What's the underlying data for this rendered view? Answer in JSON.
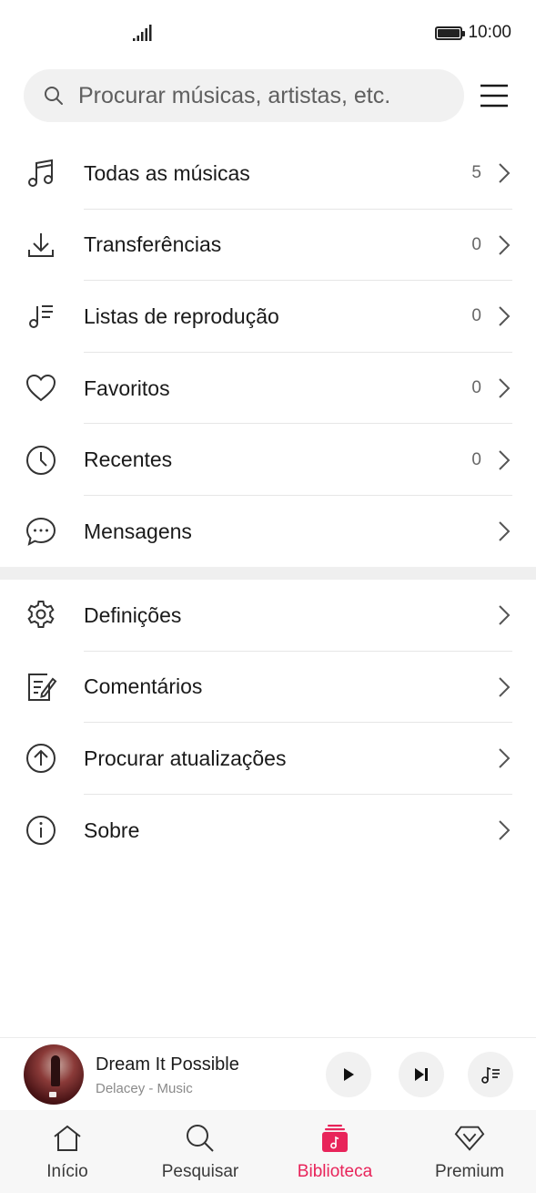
{
  "status_bar": {
    "time": "10:00",
    "icons": [
      "signal-icon",
      "battery-icon"
    ]
  },
  "search": {
    "placeholder": "Procurar músicas, artistas, etc.",
    "icons": [
      "search-icon",
      "menu-icon"
    ]
  },
  "library_items": [
    {
      "label": "Todas as músicas",
      "count": "5",
      "icon": "music-notes-icon"
    },
    {
      "label": "Transferências",
      "count": "0",
      "icon": "download-icon"
    },
    {
      "label": "Listas de reprodução",
      "count": "0",
      "icon": "playlist-icon"
    },
    {
      "label": "Favoritos",
      "count": "0",
      "icon": "heart-icon"
    },
    {
      "label": "Recentes",
      "count": "0",
      "icon": "clock-icon"
    },
    {
      "label": "Mensagens",
      "count": "",
      "icon": "chat-bubble-icon"
    }
  ],
  "settings_items": [
    {
      "label": "Definições",
      "icon": "gear-icon"
    },
    {
      "label": "Comentários",
      "icon": "feedback-edit-icon"
    },
    {
      "label": "Procurar atualizações",
      "icon": "update-arrow-icon"
    },
    {
      "label": "Sobre",
      "icon": "info-icon"
    }
  ],
  "player": {
    "title": "Dream It Possible",
    "artist": "Delacey - Music",
    "icons": [
      "album-art",
      "play-icon",
      "skip-next-icon",
      "queue-icon"
    ]
  },
  "tabs": [
    {
      "label": "Início",
      "icon": "home-icon",
      "active": false
    },
    {
      "label": "Pesquisar",
      "icon": "search-icon",
      "active": false
    },
    {
      "label": "Biblioteca",
      "icon": "library-icon",
      "active": true
    },
    {
      "label": "Premium",
      "icon": "diamond-icon",
      "active": false
    }
  ],
  "colors": {
    "accent": "#e8245a",
    "text": "#1a1a1a",
    "secondary_text": "#8a8a8a",
    "search_bg": "#f1f1f1",
    "tabbar_bg": "#f7f7f7"
  }
}
